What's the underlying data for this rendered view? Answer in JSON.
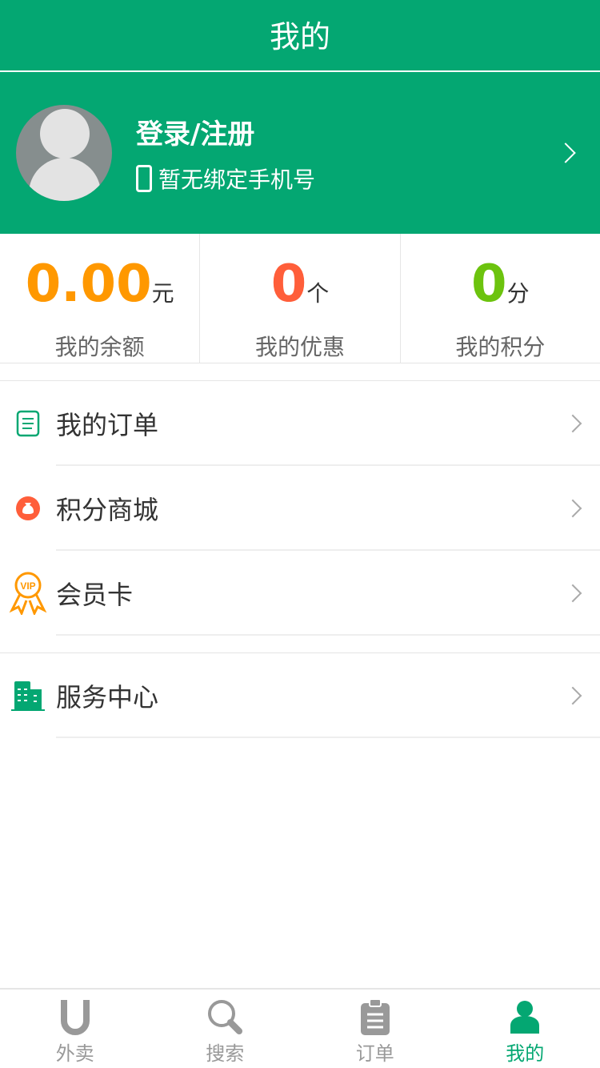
{
  "header": {
    "title": "我的"
  },
  "profile": {
    "name": "登录/注册",
    "phone": "暂无绑定手机号"
  },
  "stats": [
    {
      "value": "0.00",
      "unit": "元",
      "label": "我的余额",
      "color": "#ff9800"
    },
    {
      "value": "0",
      "unit": "个",
      "label": "我的优惠",
      "color": "#ff5e3a"
    },
    {
      "value": "0",
      "unit": "分",
      "label": "我的积分",
      "color": "#6cc30e"
    }
  ],
  "menu": [
    {
      "label": "我的订单"
    },
    {
      "label": "积分商城"
    },
    {
      "label": "会员卡",
      "badge": "VIP"
    },
    {
      "label": "服务中心"
    }
  ],
  "tabs": [
    {
      "label": "外卖"
    },
    {
      "label": "搜索"
    },
    {
      "label": "订单"
    },
    {
      "label": "我的"
    }
  ]
}
